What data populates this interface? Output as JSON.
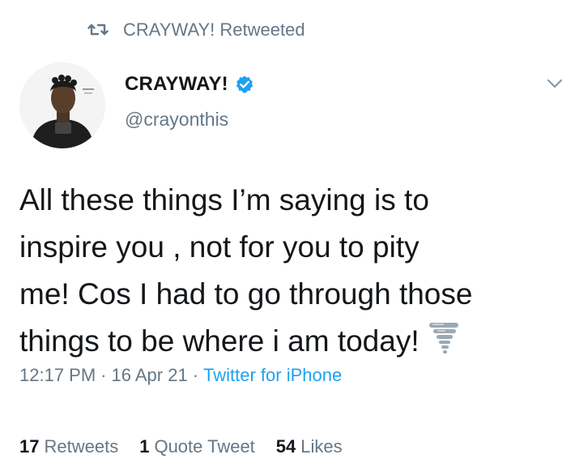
{
  "retweet_context": {
    "icon": "retweet-icon",
    "text": "CRAYWAY! Retweeted"
  },
  "author": {
    "avatar": "avatar",
    "display_name": "CRAYWAY!",
    "verified_icon": "verified-badge-icon",
    "handle": "@crayonthis"
  },
  "menu": {
    "icon": "chevron-down-icon"
  },
  "tweet": {
    "lines": [
      "All these things I’m saying is to",
      "inspire you , not for you to pity",
      "me! Cos I had to go through those",
      "things to be where i am today!"
    ],
    "emoji": "tornado-emoji-icon"
  },
  "meta": {
    "time": "12:17 PM",
    "separator": "·",
    "date": "16 Apr 21",
    "source": "Twitter for iPhone"
  },
  "stats": {
    "retweets_count": "17",
    "retweets_label": "Retweets",
    "quote_count": "1",
    "quote_label": "Quote Tweet",
    "likes_count": "54",
    "likes_label": "Likes"
  },
  "colors": {
    "secondary_text": "#657786",
    "link": "#1da1f2",
    "verified": "#1da1f2",
    "primary_text": "#14171a"
  }
}
